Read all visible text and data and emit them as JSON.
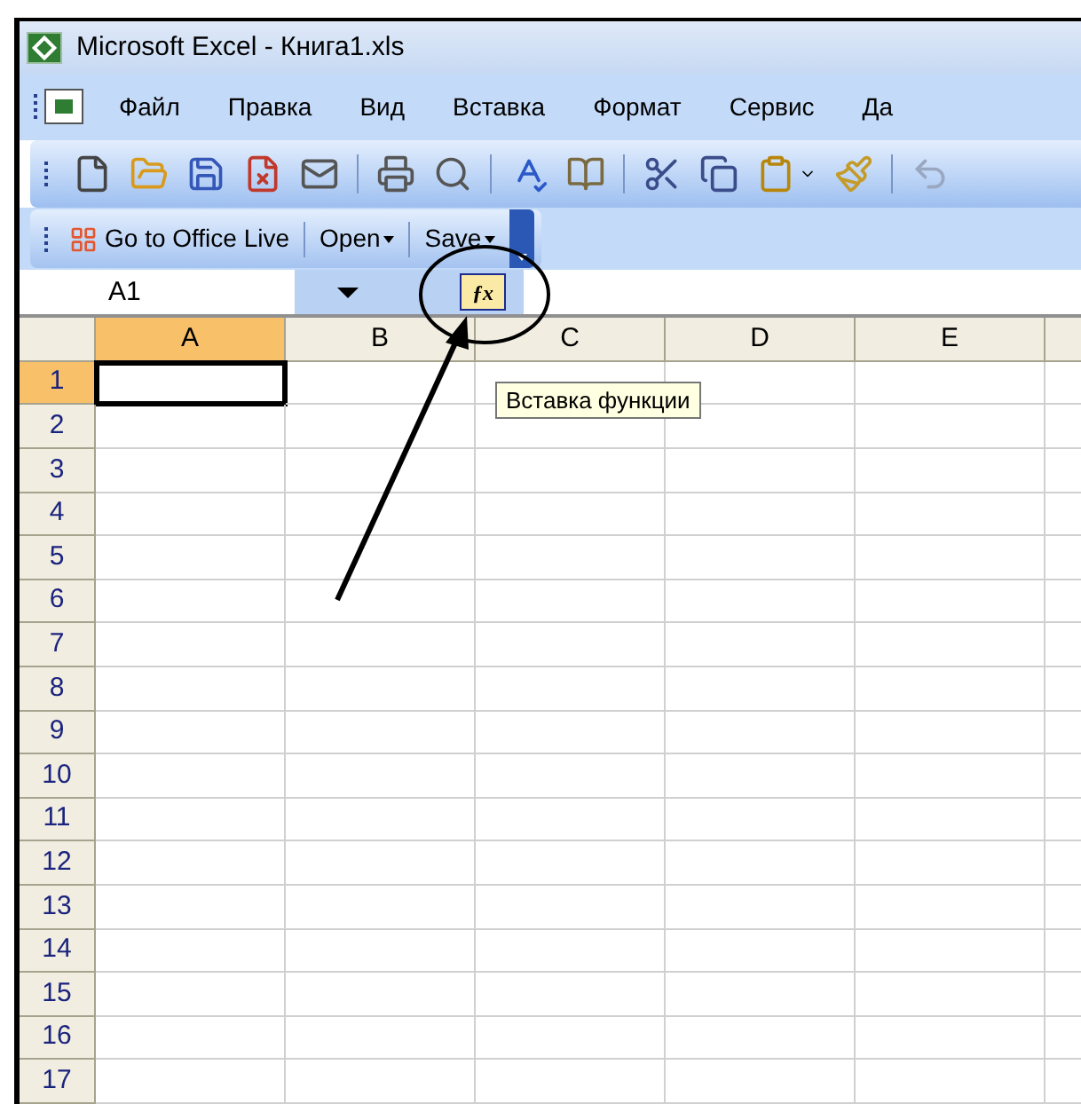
{
  "window": {
    "title": "Microsoft Excel - Книга1.xls"
  },
  "menu": [
    {
      "label": "Файл"
    },
    {
      "label": "Правка"
    },
    {
      "label": "Вид"
    },
    {
      "label": "Вставка"
    },
    {
      "label": "Формат"
    },
    {
      "label": "Сервис"
    },
    {
      "label": "Да"
    }
  ],
  "office_toolbar": [
    {
      "label": "Go to Office Live",
      "kind": "link"
    },
    {
      "label": "Open",
      "kind": "dropdown"
    },
    {
      "label": "Save",
      "kind": "dropdown"
    }
  ],
  "formula_bar": {
    "name_box": "A1",
    "function_button": "ƒx",
    "tooltip": "Вставка функции"
  },
  "columns": [
    {
      "label": "A",
      "selected": true
    },
    {
      "label": "B",
      "selected": false
    },
    {
      "label": "C",
      "selected": false
    },
    {
      "label": "D",
      "selected": false
    },
    {
      "label": "E",
      "selected": false
    }
  ],
  "rows": [
    {
      "label": "1",
      "selected": true
    },
    {
      "label": "2",
      "selected": false
    },
    {
      "label": "3",
      "selected": false
    },
    {
      "label": "4",
      "selected": false
    },
    {
      "label": "5",
      "selected": false
    },
    {
      "label": "6",
      "selected": false
    },
    {
      "label": "7",
      "selected": false
    },
    {
      "label": "8",
      "selected": false
    },
    {
      "label": "9",
      "selected": false
    },
    {
      "label": "10",
      "selected": false
    },
    {
      "label": "11",
      "selected": false
    },
    {
      "label": "12",
      "selected": false
    },
    {
      "label": "13",
      "selected": false
    },
    {
      "label": "14",
      "selected": false
    },
    {
      "label": "15",
      "selected": false
    },
    {
      "label": "16",
      "selected": false
    },
    {
      "label": "17",
      "selected": false
    }
  ]
}
